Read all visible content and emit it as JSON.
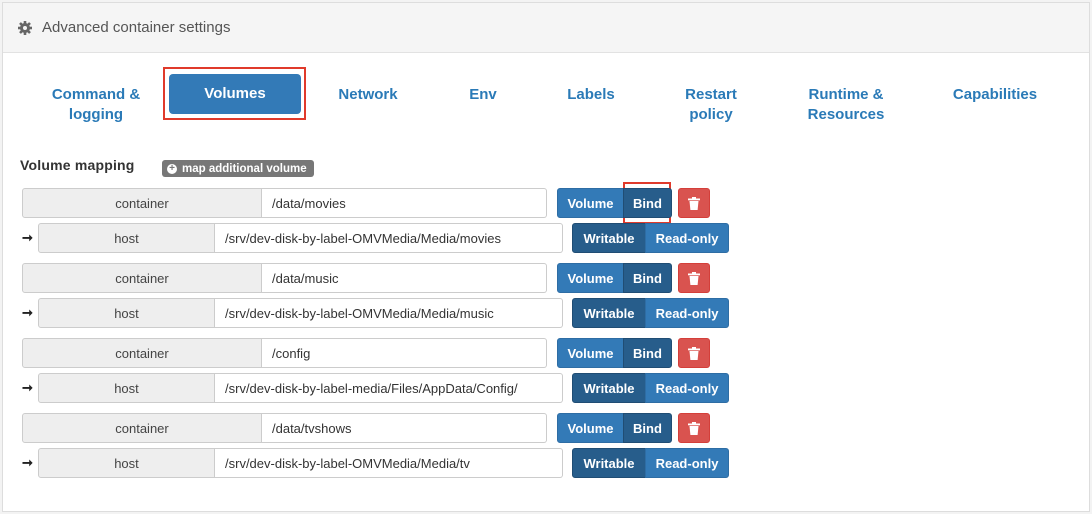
{
  "panel": {
    "title": "Advanced container settings",
    "icon": "gear-icon"
  },
  "tabs": [
    {
      "id": "command",
      "label": "Command &\nlogging"
    },
    {
      "id": "volumes",
      "label": "Volumes",
      "active": true
    },
    {
      "id": "network",
      "label": "Network"
    },
    {
      "id": "env",
      "label": "Env"
    },
    {
      "id": "labels",
      "label": "Labels"
    },
    {
      "id": "restart",
      "label": "Restart\npolicy"
    },
    {
      "id": "runtime",
      "label": "Runtime &\nResources"
    },
    {
      "id": "capabilities",
      "label": "Capabilities"
    }
  ],
  "volume_mapping": {
    "title": "Volume mapping",
    "add_label": "map additional volume",
    "container_label": "container",
    "host_label": "host",
    "type_volume": "Volume",
    "type_bind": "Bind",
    "mode_writable": "Writable",
    "mode_readonly": "Read-only",
    "arrow": "➞",
    "mappings": [
      {
        "container": "/data/movies",
        "host": "/srv/dev-disk-by-label-OMVMedia/Media/movies"
      },
      {
        "container": "/data/music",
        "host": "/srv/dev-disk-by-label-OMVMedia/Media/music"
      },
      {
        "container": "/config",
        "host": "/srv/dev-disk-by-label-media/Files/AppData/Config/"
      },
      {
        "container": "/data/tvshows",
        "host": "/srv/dev-disk-by-label-OMVMedia/Media/tv"
      }
    ]
  },
  "colors": {
    "accent": "#337ab7",
    "accent_dark": "#275d8b",
    "danger": "#d9534f",
    "highlight": "#e03a2b"
  }
}
